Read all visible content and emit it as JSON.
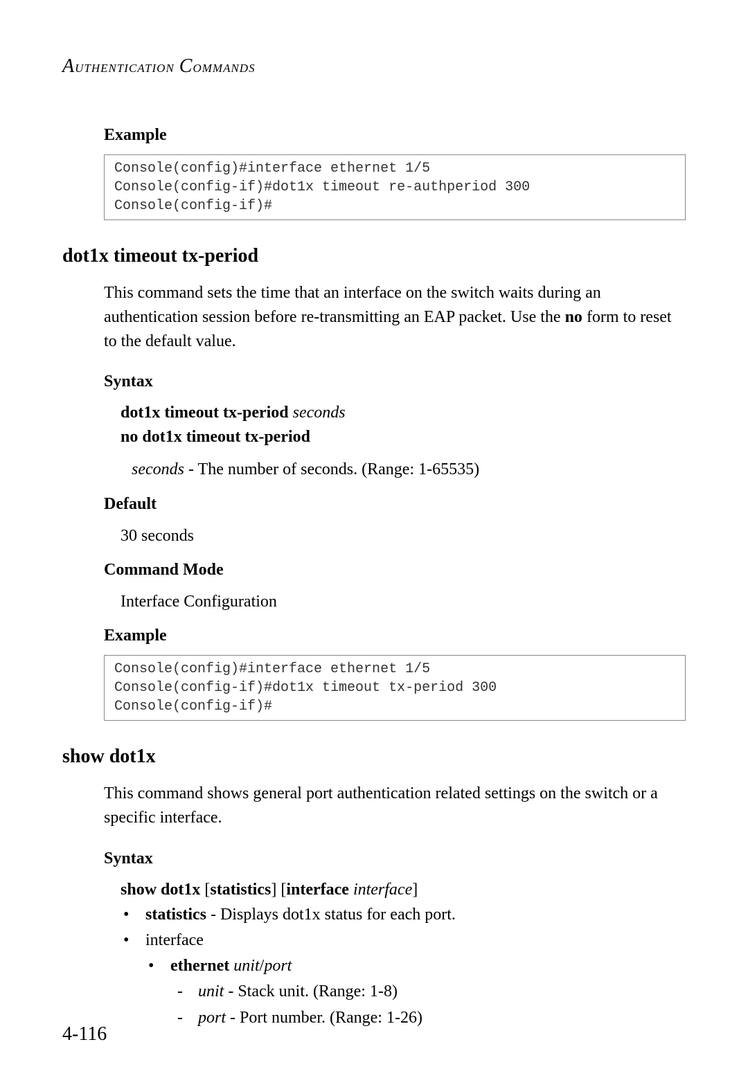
{
  "header": "Authentication Commands",
  "sec1": {
    "example_heading": "Example",
    "code": "Console(config)#interface ethernet 1/5\nConsole(config-if)#dot1x timeout re-authperiod 300\nConsole(config-if)#"
  },
  "cmd1": {
    "title": "dot1x timeout tx-period",
    "desc_pre": "This command sets the time that an interface on the switch waits during an authentication session before re-transmitting an EAP packet. Use the ",
    "desc_no": "no",
    "desc_post": " form to reset to the default value.",
    "syntax_heading": "Syntax",
    "syntax_bold1": "dot1x timeout tx-period",
    "syntax_ital1": "seconds",
    "syntax_bold2": "no dot1x timeout tx-period",
    "syntax_desc_ital": "seconds",
    "syntax_desc_rest": " - The number of seconds. (Range: 1-65535)",
    "default_heading": "Default",
    "default_val": "30 seconds",
    "mode_heading": "Command Mode",
    "mode_val": "Interface Configuration",
    "example_heading": "Example",
    "code": "Console(config)#interface ethernet 1/5\nConsole(config-if)#dot1x timeout tx-period 300\nConsole(config-if)#"
  },
  "cmd2": {
    "title": "show dot1x",
    "desc": "This command shows general port authentication related settings on the switch or a specific interface.",
    "syntax_heading": "Syntax",
    "syntax_b1": "show dot1x",
    "syntax_p1": " [",
    "syntax_b2": "statistics",
    "syntax_p2": "] [",
    "syntax_b3": "interface",
    "syntax_p3": " ",
    "syntax_i1": "interface",
    "syntax_p4": "]",
    "li1_b": "statistics",
    "li1_t": " - Displays dot1x status for each port.",
    "li2_t": "interface",
    "li3_b": "ethernet",
    "li3_i1": "unit",
    "li3_sep": "/",
    "li3_i2": "port",
    "li4_i": "unit",
    "li4_t": " - Stack unit. (Range: 1-8)",
    "li5_i": "port",
    "li5_t": " - Port number. (Range: 1-26)"
  },
  "page_number": "4-116"
}
